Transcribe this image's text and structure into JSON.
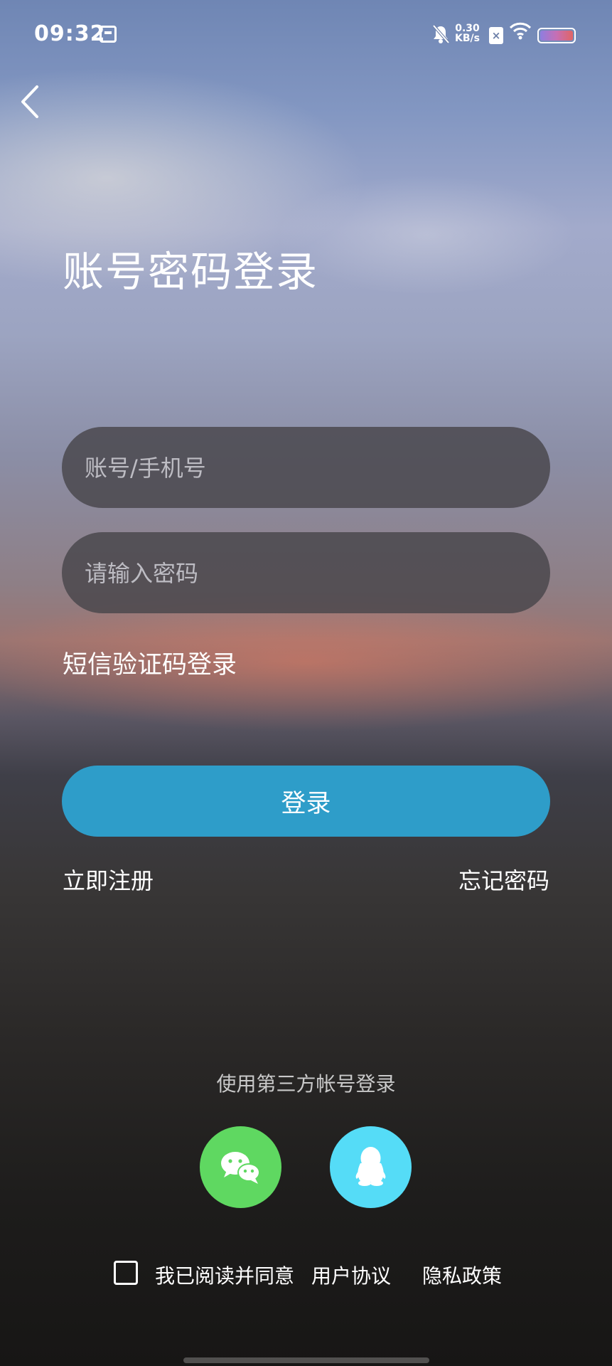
{
  "status_bar": {
    "time": "09:32",
    "net_speed_value": "0.30",
    "net_speed_unit": "KB/s",
    "icons": [
      "calendar-icon",
      "mute-icon",
      "sim-x-icon",
      "wifi-icon",
      "battery-icon"
    ]
  },
  "header": {
    "title": "账号密码登录"
  },
  "form": {
    "account_placeholder": "账号/手机号",
    "password_placeholder": "请输入密码",
    "sms_login_label": "短信验证码登录",
    "login_label": "登录",
    "register_label": "立即注册",
    "forgot_label": "忘记密码"
  },
  "third_party": {
    "title": "使用第三方帐号登录",
    "providers": [
      "wechat",
      "qq"
    ],
    "colors": {
      "wechat": "#5fd861",
      "qq": "#55dcf7"
    }
  },
  "agreement": {
    "text": "我已阅读并同意",
    "user_agreement": "用户协议",
    "privacy_policy": "隐私政策",
    "checked": false
  },
  "theme": {
    "accent": "#2e9dc9"
  }
}
